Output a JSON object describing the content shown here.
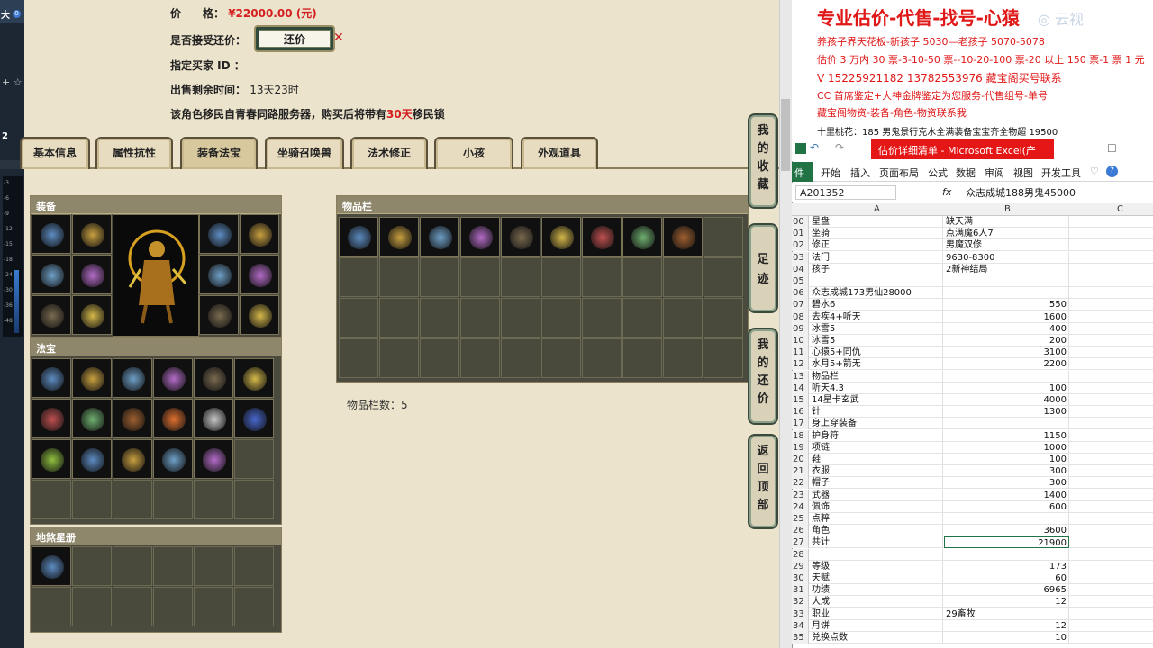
{
  "left_strip": {
    "top_label": "大",
    "dot_label": "0",
    "plus_label": "+ ☆",
    "track_number": "2",
    "meter_ticks": [
      "-3",
      "-6",
      "-9",
      "-12",
      "-15",
      "-18",
      "-24",
      "-30",
      "-36",
      "-48"
    ]
  },
  "listing": {
    "price_label": "价　　格：",
    "price_value": "¥22000.00 (元)",
    "counter_label": "是否接受还价：",
    "counter_button": "还价",
    "buyer_label": "指定买家 ID ：",
    "time_label": "出售剩余时间：",
    "time_value": "13天23时",
    "notice_prefix": "该角色移民自青春同路服务器，购买后将带有",
    "notice_days": "30天",
    "notice_suffix": "移民锁"
  },
  "tabs": [
    "基本信息",
    "属性抗性",
    "装备法宝",
    "坐骑召唤兽",
    "法术修正",
    "小孩",
    "外观道具"
  ],
  "active_tab": "装备法宝",
  "panels": {
    "equipment": "装备",
    "fabao": "法宝",
    "dishaxing": "地煞星册",
    "inventory": "物品栏",
    "inventory_count": "物品栏数：5"
  },
  "side_buttons": [
    "我的收藏",
    "足迹",
    "我的还价",
    "返回顶部"
  ],
  "ad": {
    "title": "专业估价-代售-找号-心猿",
    "lines": [
      "养孩子界天花板-新孩子 5030—老孩子 5070-5078",
      "估价 3 万内 30 票-3-10-50 票--10-20-100 票-20 以上 150 票-1 票 1 元",
      "V 15225921182 13782553976 藏宝阁买号联系",
      "CC 首席鉴定+大神金牌鉴定为您服务-代售组号-单号",
      "藏宝阁物资-装备-角色-物资联系我"
    ],
    "last_line": "十里桃花：185 男鬼景行克水全满装备宝宝齐全物超 19500",
    "watermark": "◎ 云视"
  },
  "excel": {
    "title": "估价详细清单 - Microsoft Excel(产",
    "file_tab": "件",
    "ribbon": [
      "开始",
      "插入",
      "页面布局",
      "公式",
      "数据",
      "审阅",
      "视图",
      "开发工具"
    ],
    "name_box": "A201352",
    "formula": "众志成城188男鬼45000",
    "fx": "fx",
    "columns": [
      "A",
      "B",
      "C"
    ],
    "rows": [
      {
        "n": "00",
        "a": "星盘",
        "b": "缺天满",
        "t": "txt"
      },
      {
        "n": "01",
        "a": "坐骑",
        "b": "点满魔6人7",
        "t": "txt"
      },
      {
        "n": "02",
        "a": "修正",
        "b": "男魔双修",
        "t": "txt"
      },
      {
        "n": "03",
        "a": "法门",
        "b": "9630-8300",
        "t": "txt"
      },
      {
        "n": "04",
        "a": "孩子",
        "b": "2新神结局",
        "t": "txt"
      },
      {
        "n": "05",
        "a": "",
        "b": "",
        "t": "txt"
      },
      {
        "n": "06",
        "a": "众志成城173男仙28000",
        "b": "",
        "t": "txt"
      },
      {
        "n": "07",
        "a": "碧水6",
        "b": "550",
        "t": "num"
      },
      {
        "n": "08",
        "a": "去疾4+听天",
        "b": "1600",
        "t": "num"
      },
      {
        "n": "09",
        "a": "冰雪5",
        "b": "400",
        "t": "num"
      },
      {
        "n": "10",
        "a": "冰雪5",
        "b": "200",
        "t": "num"
      },
      {
        "n": "11",
        "a": "心猿5+同仇",
        "b": "3100",
        "t": "num"
      },
      {
        "n": "12",
        "a": "水月5+箭无",
        "b": "2200",
        "t": "num"
      },
      {
        "n": "13",
        "a": "物品栏",
        "b": "",
        "t": "txt"
      },
      {
        "n": "14",
        "a": "听天4.3",
        "b": "100",
        "t": "num"
      },
      {
        "n": "15",
        "a": "14星卡玄武",
        "b": "4000",
        "t": "num"
      },
      {
        "n": "16",
        "a": "针",
        "b": "1300",
        "t": "num"
      },
      {
        "n": "17",
        "a": "身上穿装备",
        "b": "",
        "t": "txt"
      },
      {
        "n": "18",
        "a": "护身符",
        "b": "1150",
        "t": "num"
      },
      {
        "n": "19",
        "a": "项链",
        "b": "1000",
        "t": "num"
      },
      {
        "n": "20",
        "a": "鞋",
        "b": "100",
        "t": "num"
      },
      {
        "n": "21",
        "a": "衣服",
        "b": "300",
        "t": "num"
      },
      {
        "n": "22",
        "a": "帽子",
        "b": "300",
        "t": "num"
      },
      {
        "n": "23",
        "a": "武器",
        "b": "1400",
        "t": "num"
      },
      {
        "n": "24",
        "a": "佩饰",
        "b": "600",
        "t": "num"
      },
      {
        "n": "25",
        "a": "点粹",
        "b": "",
        "t": "txt"
      },
      {
        "n": "26",
        "a": "角色",
        "b": "3600",
        "t": "num"
      },
      {
        "n": "27",
        "a": "共计",
        "b": "21900",
        "t": "num"
      },
      {
        "n": "28",
        "a": "",
        "b": "",
        "t": "txt"
      },
      {
        "n": "29",
        "a": "等级",
        "b": "173",
        "t": "num"
      },
      {
        "n": "30",
        "a": "天赋",
        "b": "60",
        "t": "num"
      },
      {
        "n": "31",
        "a": "功绩",
        "b": "6965",
        "t": "num"
      },
      {
        "n": "32",
        "a": "大成",
        "b": "12",
        "t": "num"
      },
      {
        "n": "33",
        "a": "职业",
        "b": "29畜牧",
        "t": "txt"
      },
      {
        "n": "34",
        "a": "月饼",
        "b": "12",
        "t": "num"
      },
      {
        "n": "35",
        "a": "兑换点数",
        "b": "10",
        "t": "num"
      }
    ]
  }
}
